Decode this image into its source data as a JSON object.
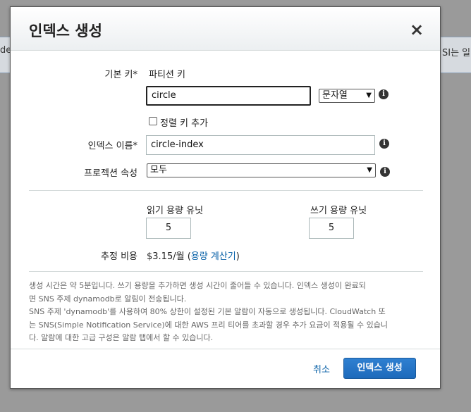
{
  "background": {
    "left_fragment": "de",
    "right_fragment": "SI는 일"
  },
  "dialog": {
    "title": "인덱스 생성",
    "close_symbol": "×",
    "primary_key_label": "기본 키*",
    "partition_key_label": "파티션 키",
    "partition_key_value": "circle",
    "partition_key_type": "문자열",
    "sort_key_checkbox_label": "정렬 키 추가",
    "sort_key_checked": false,
    "index_name_label": "인덱스 이름*",
    "index_name_value": "circle-index",
    "projection_label": "프로젝션 속성",
    "projection_value": "모두",
    "read_capacity_label": "읽기 용량 유닛",
    "read_capacity_value": "5",
    "write_capacity_label": "쓰기 용량 유닛",
    "write_capacity_value": "5",
    "cost_label": "추정 비용",
    "cost_value": "$3.15/월 (",
    "cost_link": "용량 계산기",
    "cost_close": ")",
    "notes": [
      "생성 시간은 약 5분입니다. 쓰기 용량을 추가하면 생성 시간이 줄어들 수 있습니다. 인덱스 생성이 완료되",
      "면 SNS 주제 dynamodb로 알림이 전송됩니다.",
      "SNS 주제 'dynamodb'를 사용하여 80% 상한이 설정된 기본 알람이 자동으로 생성됩니다. CloudWatch 또",
      "는 SNS(Simple Notification Service)에 대한 AWS 프리 티어를 초과할 경우 추가 요금이 적용될 수 있습니",
      "다. 알람에 대한 고급 구성은 알람 탭에서 할 수 있습니다."
    ],
    "cancel_label": "취소",
    "create_button_label": "인덱스 생성"
  },
  "icons": {
    "info": "info-icon",
    "close": "close-icon",
    "dropdown": "chevron-down-icon"
  },
  "colors": {
    "primary_button": "#1d6abb",
    "link": "#0a62a8",
    "overlay": "#9a9a9a"
  }
}
